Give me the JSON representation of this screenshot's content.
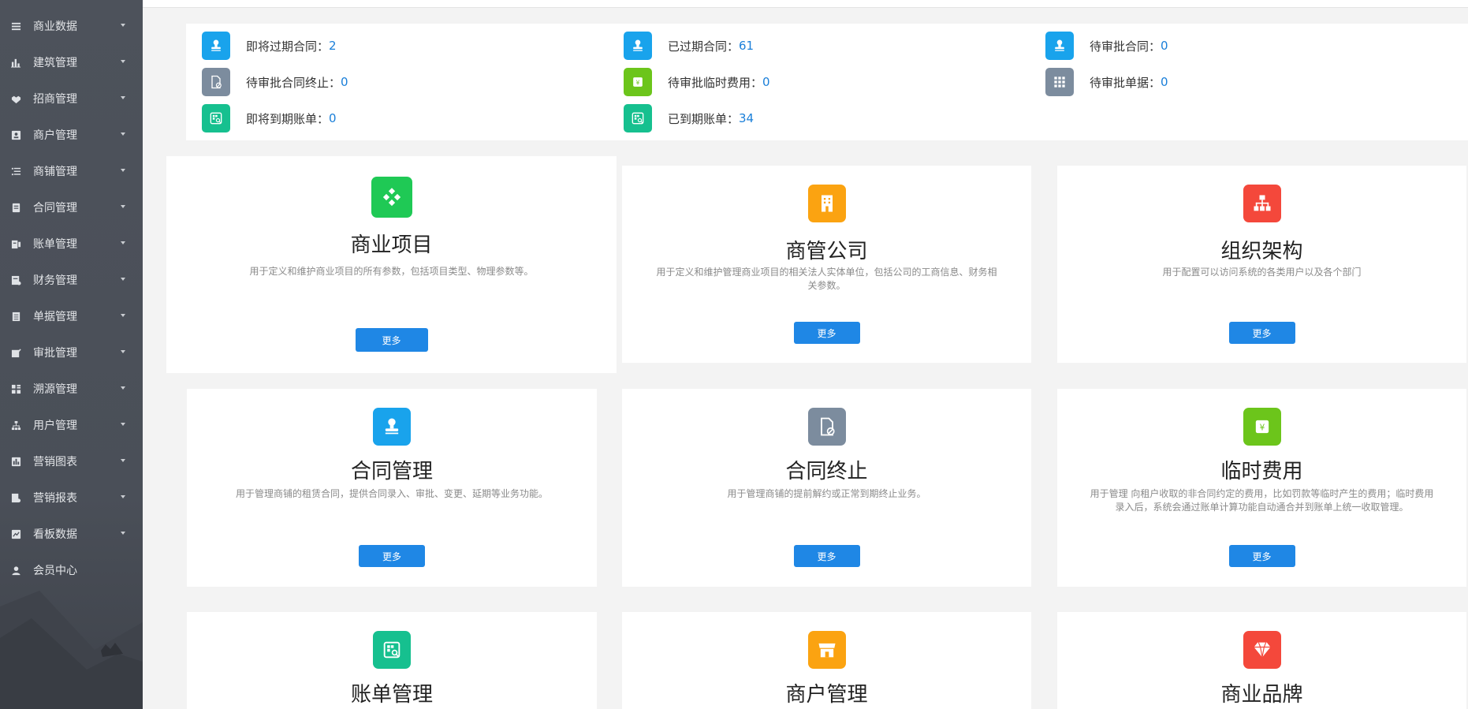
{
  "sidebar": {
    "items": [
      {
        "label": "商业数据",
        "icon": "list-icon",
        "has_caret": true
      },
      {
        "label": "建筑管理",
        "icon": "bar-chart-icon",
        "has_caret": true
      },
      {
        "label": "招商管理",
        "icon": "handshake-icon",
        "has_caret": true
      },
      {
        "label": "商户管理",
        "icon": "contact-card-icon",
        "has_caret": true
      },
      {
        "label": "商铺管理",
        "icon": "indent-list-icon",
        "has_caret": true
      },
      {
        "label": "合同管理",
        "icon": "document-icon",
        "has_caret": true
      },
      {
        "label": "账单管理",
        "icon": "bill-icon",
        "has_caret": true
      },
      {
        "label": "财务管理",
        "icon": "finance-doc-icon",
        "has_caret": true
      },
      {
        "label": "单据管理",
        "icon": "receipt-icon",
        "has_caret": true
      },
      {
        "label": "审批管理",
        "icon": "approve-icon",
        "has_caret": true
      },
      {
        "label": "溯源管理",
        "icon": "grid-icon",
        "has_caret": true
      },
      {
        "label": "用户管理",
        "icon": "org-tree-icon",
        "has_caret": true
      },
      {
        "label": "营销图表",
        "icon": "column-chart-icon",
        "has_caret": true
      },
      {
        "label": "营销报表",
        "icon": "report-icon",
        "has_caret": true
      },
      {
        "label": "看板数据",
        "icon": "line-chart-icon",
        "has_caret": true
      },
      {
        "label": "会员中心",
        "icon": "user-icon",
        "has_caret": false
      }
    ]
  },
  "summary": {
    "stats": [
      {
        "label": "即将过期合同：",
        "value": "2",
        "icon": "stamp-icon",
        "color": "#19a3ec"
      },
      {
        "label": "已过期合同：",
        "value": "61",
        "icon": "stamp-icon",
        "color": "#19a3ec"
      },
      {
        "label": "待审批合同：",
        "value": "0",
        "icon": "stamp-icon",
        "color": "#19a3ec"
      },
      {
        "label": "待审批合同终止：",
        "value": "0",
        "icon": "file-ban-icon",
        "color": "#7c8c9e"
      },
      {
        "label": "待审批临时费用：",
        "value": "0",
        "icon": "yen-icon",
        "color": "#6cc51b"
      },
      {
        "label": "待审批单据：",
        "value": "0",
        "icon": "grid-dots-icon",
        "color": "#7c8c9e"
      },
      {
        "label": "即将到期账单：",
        "value": "0",
        "icon": "bill-search-icon",
        "color": "#16c08f"
      },
      {
        "label": "已到期账单：",
        "value": "34",
        "icon": "bill-search-icon",
        "color": "#16c08f"
      }
    ]
  },
  "cards": [
    {
      "title": "商业项目",
      "desc": "用于定义和维护商业项目的所有参数，包括项目类型、物理参数等。",
      "button": "更多",
      "icon": "diamond-grid-icon",
      "color": "#1fc955"
    },
    {
      "title": "商管公司",
      "desc": "用于定义和维护管理商业项目的相关法人实体单位，包括公司的工商信息、财务相关参数。",
      "button": "更多",
      "icon": "building-icon",
      "color": "#fba311"
    },
    {
      "title": "组织架构",
      "desc": "用于配置可以访问系统的各类用户以及各个部门",
      "button": "更多",
      "icon": "org-chart-icon",
      "color": "#f4483b"
    },
    {
      "title": "合同管理",
      "desc": "用于管理商铺的租赁合同，提供合同录入、审批、变更、延期等业务功能。",
      "button": "更多",
      "icon": "stamp-icon",
      "color": "#19a3ec"
    },
    {
      "title": "合同终止",
      "desc": "用于管理商铺的提前解约或正常到期终止业务。",
      "button": "更多",
      "icon": "file-ban-icon",
      "color": "#7c8c9e"
    },
    {
      "title": "临时费用",
      "desc": "用于管理 向租户收取的非合同约定的费用，比如罚款等临时产生的费用；临时费用录入后，系统会通过账单计算功能自动通合并到账单上统一收取管理。",
      "button": "更多",
      "icon": "yen-icon",
      "color": "#6cc51b"
    },
    {
      "title": "账单管理",
      "desc": "",
      "button": "",
      "icon": "bill-search-icon",
      "color": "#16c08f"
    },
    {
      "title": "商户管理",
      "desc": "",
      "button": "",
      "icon": "shop-icon",
      "color": "#fba311"
    },
    {
      "title": "商业品牌",
      "desc": "",
      "button": "",
      "icon": "diamond-icon",
      "color": "#f4483b"
    }
  ]
}
